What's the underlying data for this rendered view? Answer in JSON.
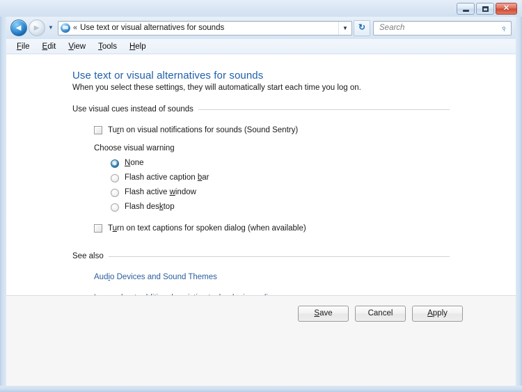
{
  "window": {
    "controls": {
      "minimize_label": "Minimize",
      "maximize_label": "Maximize",
      "close_label": "✕"
    }
  },
  "navbar": {
    "back_arrow": "◄",
    "forward_arrow": "►",
    "history_arrow": "▼",
    "breadcrumb_chevrons": "«",
    "address_text": "Use text or visual alternatives for sounds",
    "address_dropdown_arrow": "▼",
    "refresh_glyph": "↻",
    "search_placeholder": "Search",
    "search_value": "",
    "search_glyph": "⌕"
  },
  "menubar": {
    "items": [
      {
        "pre": "",
        "accel": "F",
        "post": "ile"
      },
      {
        "pre": "",
        "accel": "E",
        "post": "dit"
      },
      {
        "pre": "",
        "accel": "V",
        "post": "iew"
      },
      {
        "pre": "",
        "accel": "T",
        "post": "ools"
      },
      {
        "pre": "",
        "accel": "H",
        "post": "elp"
      }
    ]
  },
  "page": {
    "title": "Use text or visual alternatives for sounds",
    "subtitle": "When you select these settings, they will automatically start each time you log on.",
    "visual_cues_group": {
      "header": "Use visual cues instead of sounds",
      "sound_sentry": {
        "pre": "Tu",
        "accel": "r",
        "post": "n on visual notifications for sounds (Sound Sentry)",
        "checked": false
      },
      "choose_warning_label": "Choose visual warning",
      "warning_options": [
        {
          "pre": "",
          "accel": "N",
          "post": "one",
          "selected": true
        },
        {
          "pre": "Flash active caption ",
          "accel": "b",
          "post": "ar",
          "selected": false
        },
        {
          "pre": "Flash active ",
          "accel": "w",
          "post": "indow",
          "selected": false
        },
        {
          "pre": "Flash des",
          "accel": "k",
          "post": "top",
          "selected": false
        }
      ],
      "text_captions": {
        "pre": "T",
        "accel": "u",
        "post": "rn on text captions for spoken dialog (when available)",
        "checked": false
      }
    },
    "see_also_group": {
      "header": "See also",
      "links": [
        {
          "pre": "Aud",
          "accel": "i",
          "post": "o Devices and Sound Themes",
          "underlined": false
        },
        {
          "pre": "Learn about additional assistive technologies online",
          "accel": "",
          "post": "",
          "underlined": true
        }
      ]
    }
  },
  "footer": {
    "buttons": [
      {
        "pre": "",
        "accel": "S",
        "post": "ave"
      },
      {
        "pre": "Cancel",
        "accel": "",
        "post": ""
      },
      {
        "pre": "",
        "accel": "A",
        "post": "pply"
      }
    ]
  },
  "colors": {
    "heading_blue": "#1F5FA9",
    "link_blue": "#2A5D9C",
    "frame_blue": "#C8DAEE",
    "close_red": "#CD4A32"
  }
}
